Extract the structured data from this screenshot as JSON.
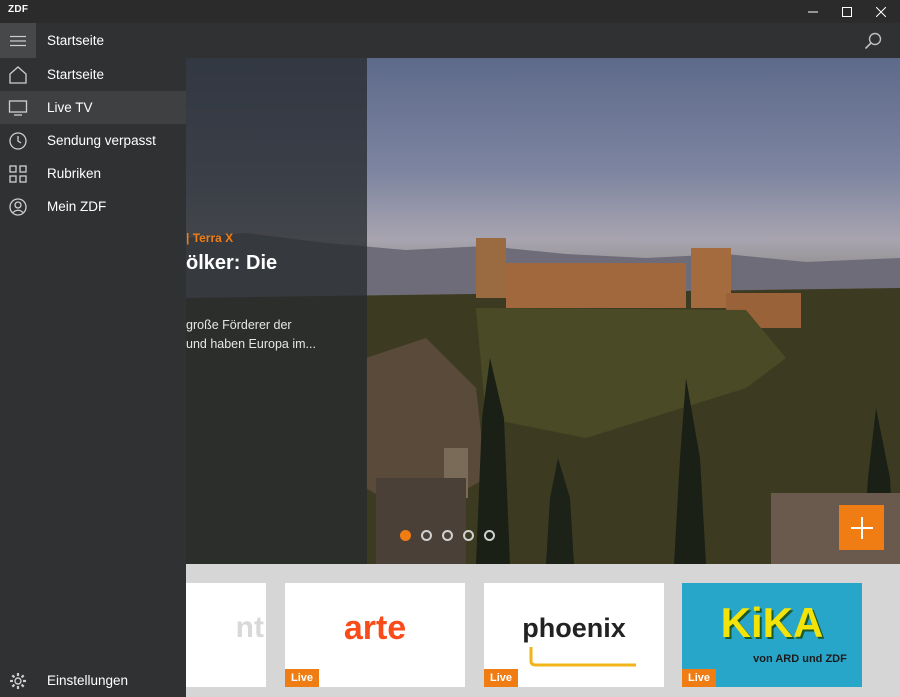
{
  "window": {
    "title": "ZDF"
  },
  "header": {
    "title": "Startseite"
  },
  "sidebar": {
    "items": [
      {
        "label": "Startseite",
        "icon": "home-icon"
      },
      {
        "label": "Live TV",
        "icon": "tv-icon"
      },
      {
        "label": "Sendung verpasst",
        "icon": "clock-icon"
      },
      {
        "label": "Rubriken",
        "icon": "grid-icon"
      },
      {
        "label": "Mein ZDF",
        "icon": "user-circle-icon"
      }
    ],
    "settings": {
      "label": "Einstellungen",
      "icon": "gear-icon"
    }
  },
  "hero": {
    "kicker": "| Terra X",
    "title": "ölker: Die",
    "teaser_line1": "große Förderer der",
    "teaser_line2": "und haben Europa im..."
  },
  "carousel": {
    "count": 5,
    "active_index": 0
  },
  "live_strip": {
    "tiles": [
      {
        "logo": "nt",
        "badge": ""
      },
      {
        "logo": "arte",
        "badge": "Live"
      },
      {
        "logo": "phoenix",
        "badge": "Live"
      },
      {
        "logo": "KiKA",
        "sub": "von ARD und ZDF",
        "badge": "Live"
      }
    ]
  },
  "colors": {
    "accent": "#f07d14",
    "sidebar_bg": "#2f3133",
    "arte": "#fa4b1a",
    "kika_yellow": "#f2e30a"
  }
}
